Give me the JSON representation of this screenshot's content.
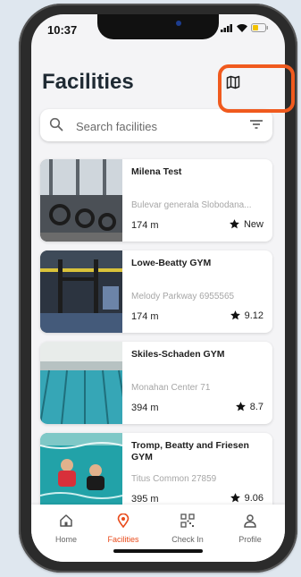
{
  "status_bar": {
    "time": "10:37"
  },
  "page": {
    "title": "Facilities"
  },
  "search": {
    "placeholder": "Search facilities"
  },
  "facilities": [
    {
      "name": "Milena Test",
      "address": "Bulevar generala Slobodana...",
      "distance": "174 m",
      "rating": "New"
    },
    {
      "name": "Lowe-Beatty GYM",
      "address": "Melody Parkway 6955565",
      "distance": "174 m",
      "rating": "9.12"
    },
    {
      "name": "Skiles-Schaden GYM",
      "address": "Monahan Center 71",
      "distance": "394 m",
      "rating": "8.7"
    },
    {
      "name": "Tromp, Beatty and Friesen GYM",
      "address": "Titus Common 27859",
      "distance": "395 m",
      "rating": "9.06"
    }
  ],
  "tabs": [
    {
      "label": "Home"
    },
    {
      "label": "Facilities"
    },
    {
      "label": "Check In"
    },
    {
      "label": "Profile"
    }
  ],
  "colors": {
    "accent": "#e94b1b",
    "highlight": "#f05a1e"
  }
}
